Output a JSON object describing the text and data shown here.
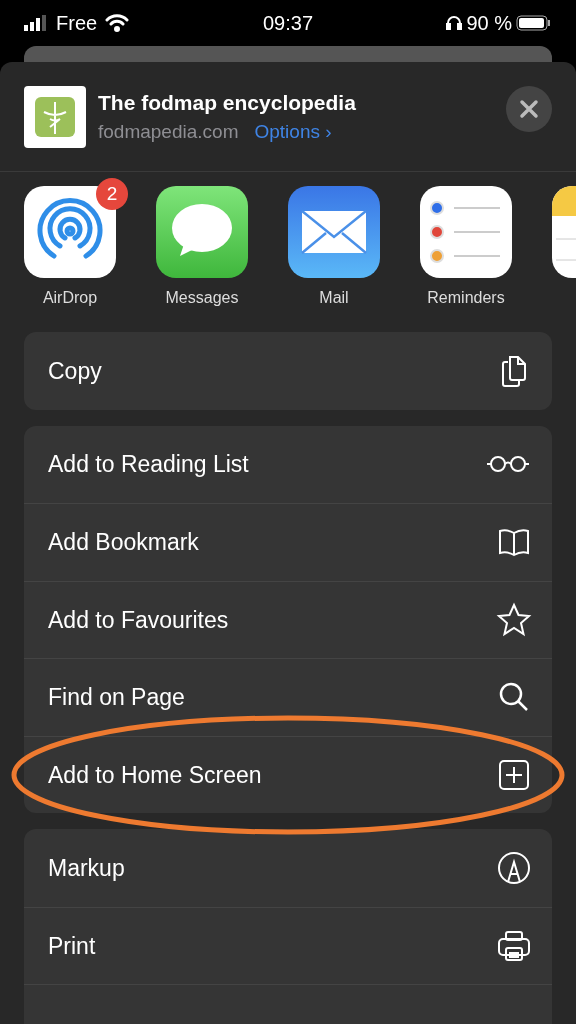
{
  "status_bar": {
    "carrier": "Free",
    "time": "09:37",
    "battery": "90 %"
  },
  "header": {
    "title": "The fodmap encyclopedia",
    "domain": "fodmapedia.com",
    "options": "Options ›"
  },
  "apps": [
    {
      "kind": "airdrop",
      "label": "AirDrop",
      "badge": "2"
    },
    {
      "kind": "messages",
      "label": "Messages"
    },
    {
      "kind": "mail",
      "label": "Mail"
    },
    {
      "kind": "reminders",
      "label": "Reminders"
    },
    {
      "kind": "notes"
    }
  ],
  "groups": [
    [
      {
        "label": "Copy",
        "kind": "copy",
        "highlighted": false
      }
    ],
    [
      {
        "label": "Add to Reading List",
        "kind": "glasses",
        "highlighted": false
      },
      {
        "label": "Add Bookmark",
        "kind": "book",
        "highlighted": false
      },
      {
        "label": "Add to Favourites",
        "kind": "star",
        "highlighted": false
      },
      {
        "label": "Find on Page",
        "kind": "search",
        "highlighted": false
      },
      {
        "label": "Add to Home Screen",
        "kind": "plus-square",
        "highlighted": true
      }
    ],
    [
      {
        "label": "Markup",
        "kind": "markup",
        "highlighted": false
      },
      {
        "label": "Print",
        "kind": "print",
        "highlighted": false
      },
      {
        "kind": "cut"
      }
    ]
  ]
}
